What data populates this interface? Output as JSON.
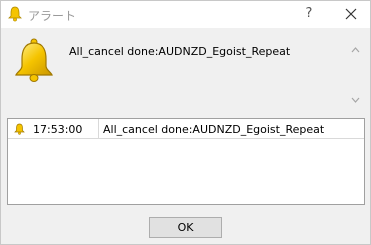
{
  "window": {
    "title": "アラート",
    "help_label": "?",
    "close_icon": "close-icon",
    "title_icon": "bell-icon"
  },
  "alert": {
    "message": "All_cancel done:AUDNZD_Egoist_Repeat",
    "icon": "bell-icon"
  },
  "log": {
    "rows": [
      {
        "icon": "bell-icon",
        "time": "17:53:00",
        "message": "All_cancel done:AUDNZD_Egoist_Repeat"
      }
    ]
  },
  "buttons": {
    "ok_label": "OK"
  },
  "colors": {
    "bell": "#f5c400",
    "bell_outline": "#b08a00",
    "titlebar": "#ffffff",
    "background": "#f0f0f0"
  }
}
